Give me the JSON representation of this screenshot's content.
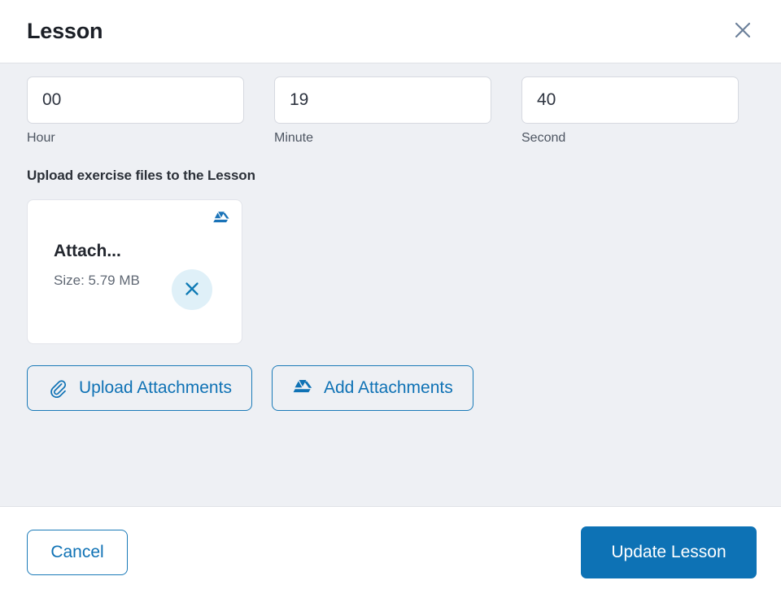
{
  "header": {
    "title": "Lesson",
    "close_icon": "close-icon"
  },
  "duration": {
    "fields": [
      {
        "value": "00",
        "label": "Hour",
        "placeholder": "Hour"
      },
      {
        "value": "19",
        "label": "Minute",
        "placeholder": "Minute"
      },
      {
        "value": "40",
        "label": "Second",
        "placeholder": "Second"
      }
    ]
  },
  "upload": {
    "section_title": "Upload exercise files to the Lesson",
    "attachments": [
      {
        "name": "Attach...",
        "size": "Size: 5.79 MB",
        "source_icon": "google-drive-icon",
        "remove_icon": "close-icon"
      }
    ],
    "buttons": [
      {
        "label": "Upload Attachments",
        "icon": "paperclip-icon"
      },
      {
        "label": "Add Attachments",
        "icon": "google-drive-icon"
      }
    ]
  },
  "footer": {
    "cancel_label": "Cancel",
    "submit_label": "Update Lesson"
  },
  "colors": {
    "accent": "#0d72b5",
    "accent_border": "#1a7ab8",
    "body_background": "#eef0f4",
    "divider": "#dfe1e6",
    "remove_circle": "#dff0f8",
    "drive_blue": "#1a73b8",
    "title_text": "#1b1f26"
  }
}
